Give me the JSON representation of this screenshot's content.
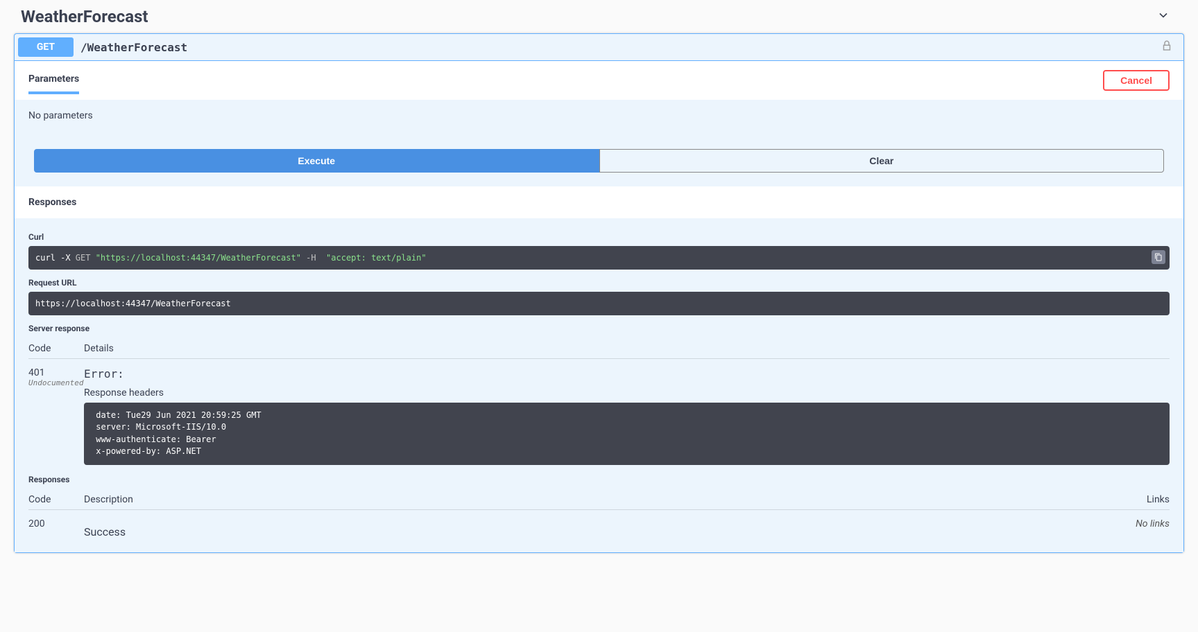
{
  "tag": {
    "name": "WeatherForecast"
  },
  "op": {
    "method": "GET",
    "path": "/WeatherForecast"
  },
  "parameters": {
    "tab_label": "Parameters",
    "cancel_label": "Cancel",
    "empty": "No parameters"
  },
  "actions": {
    "execute": "Execute",
    "clear": "Clear"
  },
  "responses_heading": "Responses",
  "curl": {
    "label": "Curl",
    "prefix": "curl -X ",
    "method": "GET ",
    "url": "\"https://localhost:44347/WeatherForecast\"",
    "flag": " -H  ",
    "header": "\"accept: text/plain\""
  },
  "request_url": {
    "label": "Request URL",
    "value": "https://localhost:44347/WeatherForecast"
  },
  "server_response": {
    "label": "Server response",
    "cols": {
      "code": "Code",
      "details": "Details"
    },
    "code": "401",
    "undocumented": "Undocumented",
    "error": "Error:",
    "headers_label": "Response headers",
    "headers": " date: Tue29 Jun 2021 20:59:25 GMT \n server: Microsoft-IIS/10.0 \n www-authenticate: Bearer \n x-powered-by: ASP.NET "
  },
  "documented": {
    "label": "Responses",
    "cols": {
      "code": "Code",
      "description": "Description",
      "links": "Links"
    },
    "row": {
      "code": "200",
      "description": "Success",
      "links": "No links"
    }
  }
}
